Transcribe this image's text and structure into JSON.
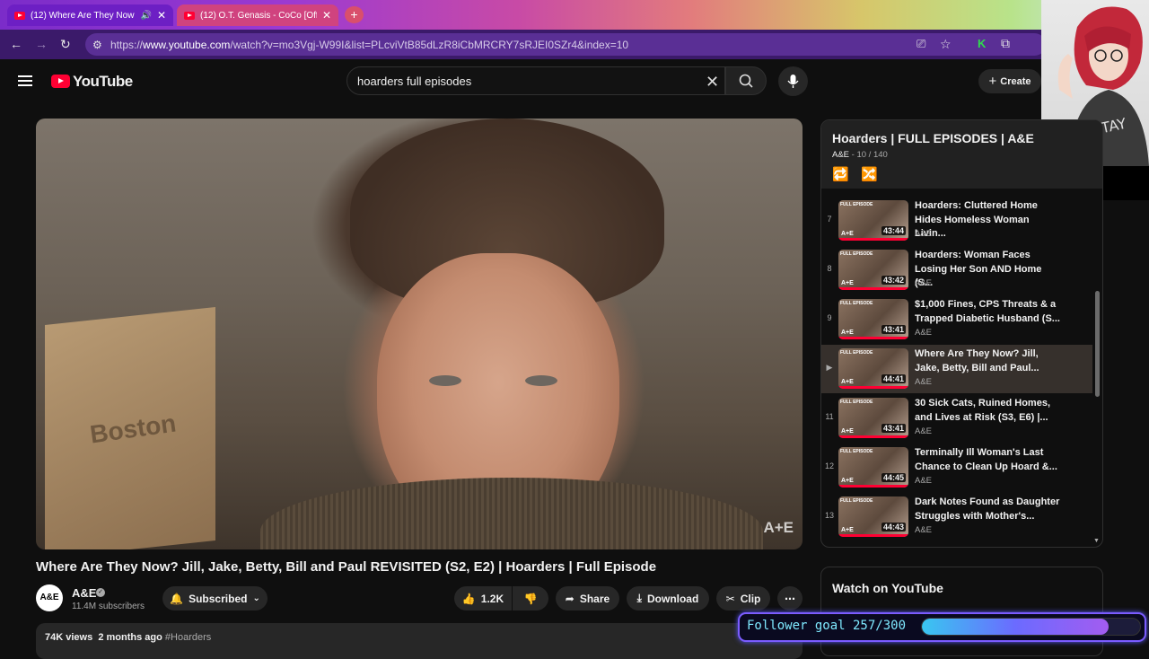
{
  "browser": {
    "tabs": [
      {
        "title": "(12) Where Are They Now?",
        "active": true
      },
      {
        "title": "(12) O.T. Genasis - CoCo [Offici",
        "active": false
      }
    ],
    "url_prefix": "https://",
    "url_host": "www.youtube.com",
    "url_path": "/watch?v=mo3Vgj-W99I&list=PLcviVtB85dLzR8iCbMRCRY7sRJEI0SZr4&index=10"
  },
  "header": {
    "logo": "YouTube",
    "search_value": "hoarders full episodes",
    "create_label": "Create"
  },
  "video": {
    "title": "Where Are They Now? Jill, Jake, Betty, Bill and Paul REVISITED (S2, E2) | Hoarders | Full Episode",
    "watermark": "A+E",
    "box_text": "Boston"
  },
  "channel": {
    "avatar": "A&E",
    "name": "A&E",
    "subscribers": "11.4M subscribers",
    "subscribe_label": "Subscribed"
  },
  "actions": {
    "likes": "1.2K",
    "share": "Share",
    "download": "Download",
    "clip": "Clip"
  },
  "description": {
    "views": "74K views",
    "age": "2 months ago",
    "hashtag": "#Hoarders"
  },
  "playlist": {
    "title": "Hoarders | FULL EPISODES | A&E",
    "channel": "A&E",
    "position": "10 / 140",
    "items": [
      {
        "num": "7",
        "line1": "Hoarders: Cluttered Home",
        "line2": "Hides Homeless Woman Livin...",
        "channel": "A&E",
        "duration": "43:44",
        "badge": "FULL EPISODE",
        "ae": "A+E"
      },
      {
        "num": "8",
        "line1": "Hoarders: Woman Faces",
        "line2": "Losing Her Son AND Home (S...",
        "channel": "A&E",
        "duration": "43:42",
        "badge": "FULL EPISODE",
        "ae": "A+E"
      },
      {
        "num": "9",
        "line1": "$1,000 Fines, CPS Threats & a",
        "line2": "Trapped Diabetic Husband (S...",
        "channel": "A&E",
        "duration": "43:41",
        "badge": "FULL EPISODE",
        "ae": "A+E"
      },
      {
        "num": "▶",
        "line1": "Where Are They Now? Jill,",
        "line2": "Jake, Betty, Bill and Paul...",
        "channel": "A&E",
        "duration": "44:41",
        "badge": "FULL EPISODE",
        "ae": "A+E"
      },
      {
        "num": "11",
        "line1": "30 Sick Cats, Ruined Homes,",
        "line2": "and Lives at Risk (S3, E6) |...",
        "channel": "A&E",
        "duration": "43:41",
        "badge": "FULL EPISODE",
        "ae": "A+E"
      },
      {
        "num": "12",
        "line1": "Terminally Ill Woman's Last",
        "line2": "Chance to Clean Up Hoard &...",
        "channel": "A&E",
        "duration": "44:45",
        "badge": "FULL EPISODE",
        "ae": "A+E"
      },
      {
        "num": "13",
        "line1": "Dark Notes Found as Daughter",
        "line2": "Struggles with Mother's...",
        "channel": "A&E",
        "duration": "44:43",
        "badge": "FULL EPISODE",
        "ae": "A+E"
      }
    ]
  },
  "watch_on_youtube": "Watch on YouTube",
  "overlay": {
    "goal_label": "Follower goal 257/300",
    "goal_current": 257,
    "goal_target": 300
  }
}
